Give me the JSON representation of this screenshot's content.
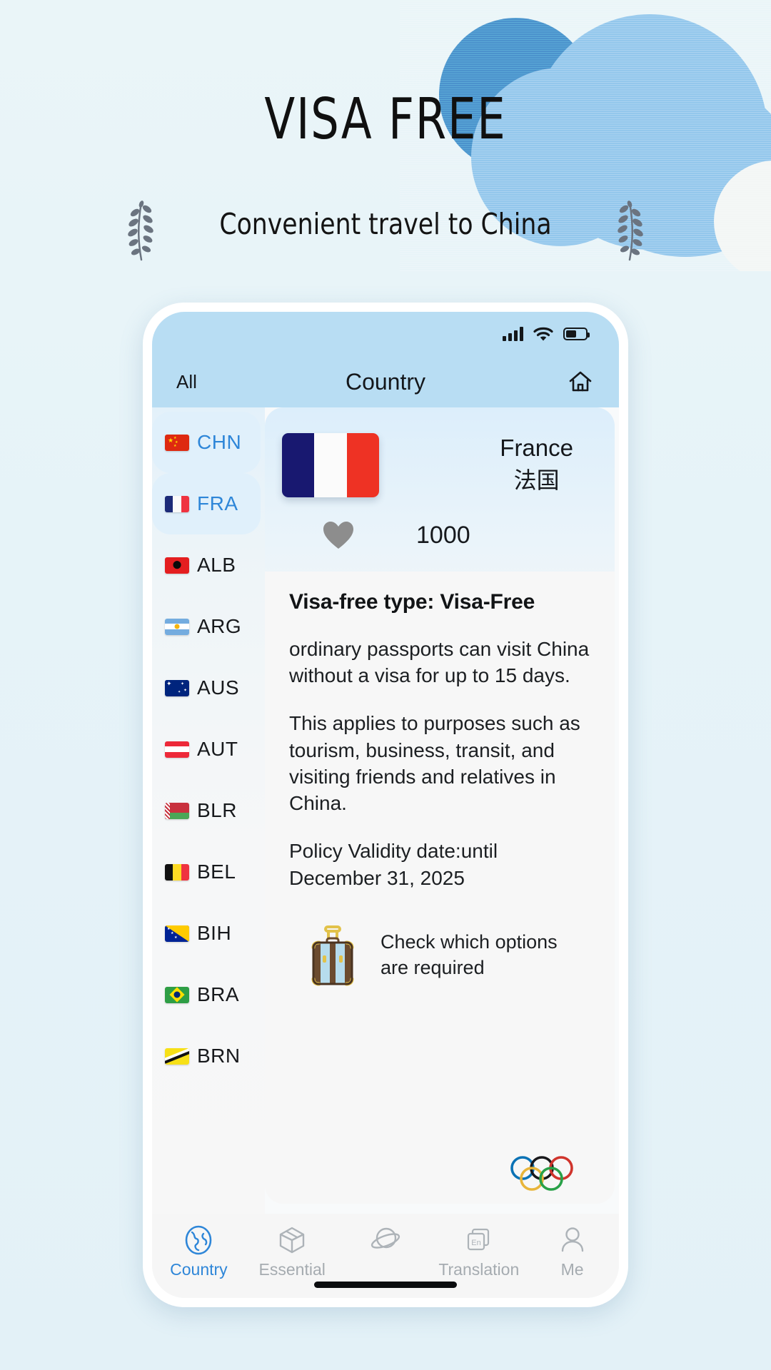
{
  "poster": {
    "title": "VISA FREE",
    "subtitle": "Convenient travel to China",
    "laurel_icon": "laurel-branch-icon",
    "cloud_icon": "cloud-decoration"
  },
  "statusbar": {
    "signal_icon": "signal-bars-icon",
    "wifi_icon": "wifi-icon",
    "battery_icon": "battery-icon",
    "battery_level": "55%"
  },
  "nav": {
    "left_label": "All",
    "title": "Country",
    "home_icon": "home-icon"
  },
  "sidebar": {
    "items": [
      {
        "code": "CHN",
        "flag": "cn",
        "selected": true
      },
      {
        "code": "FRA",
        "flag": "fr",
        "selected": true
      },
      {
        "code": "ALB",
        "flag": "al",
        "selected": false
      },
      {
        "code": "ARG",
        "flag": "ar",
        "selected": false
      },
      {
        "code": "AUS",
        "flag": "au",
        "selected": false
      },
      {
        "code": "AUT",
        "flag": "at",
        "selected": false
      },
      {
        "code": "BLR",
        "flag": "by",
        "selected": false
      },
      {
        "code": "BEL",
        "flag": "be",
        "selected": false
      },
      {
        "code": "BIH",
        "flag": "ba",
        "selected": false
      },
      {
        "code": "BRA",
        "flag": "br",
        "selected": false
      },
      {
        "code": "BRN",
        "flag": "bn",
        "selected": false
      }
    ]
  },
  "detail": {
    "flag_icon": "france-flag-icon",
    "name_en": "France",
    "name_cn": "法国",
    "heart_icon": "heart-icon",
    "like_count": "1000",
    "visa_type_label": "Visa-free type: Visa-Free",
    "paragraph_1": "ordinary passports can visit China without a visa for up to 15 days.",
    "paragraph_2": "This applies to purposes such as tourism, business, transit, and visiting friends and relatives in China.",
    "paragraph_3": "Policy Validity date:until December 31, 2025",
    "suitcase_icon": "suitcase-icon",
    "suitcase_text": "Check which options are required",
    "rings_icon": "olympic-rings-icon"
  },
  "tabbar": {
    "tabs": [
      {
        "label": "Country",
        "icon": "globe-icon",
        "active": true
      },
      {
        "label": "Essential",
        "icon": "box-icon",
        "active": false
      },
      {
        "label": "",
        "icon": "planet-icon",
        "active": false
      },
      {
        "label": "Translation",
        "icon": "translate-en-icon",
        "active": false
      },
      {
        "label": "Me",
        "icon": "person-icon",
        "active": false
      }
    ],
    "home_indicator": "home-indicator"
  },
  "colors": {
    "accent": "#2e86d8",
    "header": "#b8ddf3",
    "page_bg": "#e8f4f8",
    "cloud_dark": "#4b92cc",
    "cloud_light": "#93c7ec"
  }
}
